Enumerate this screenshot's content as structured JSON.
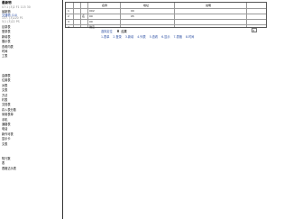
{
  "sidebar": {
    "title": "最新物",
    "lines": [
      {
        "text": "07:1 (3)2 F1 115 30",
        "tone": "grey"
      },
      {
        "text": "最新物",
        "tone": "normal"
      },
      {
        "text": "交通物 (14)",
        "tone": "blue"
      },
      {
        "text": "137. (3)220 P1",
        "tone": "grey"
      },
      {
        "text": "5/1 (3)22 PS",
        "tone": "grey"
      }
    ],
    "items": [
      "目录表",
      "登录表",
      "新增表",
      "展示表",
      "查看内表",
      "时间",
      "工表",
      "",
      "",
      "",
      "会期表",
      "位置表",
      "对表",
      "文表",
      "方法",
      "村表",
      "文档表",
      "存入表分数",
      "采用表单",
      "手机",
      "通路表",
      "电话",
      "新作可表",
      "显示卡",
      "文表",
      "",
      "",
      "知行数",
      "表",
      "表格达示表"
    ]
  },
  "grid": {
    "headers": [
      "名称",
      "地址",
      "说明"
    ],
    "rows": [
      {
        "num": "1",
        "a": "",
        "b": "",
        "c": "002",
        "d": "00"
      },
      {
        "num": "2",
        "a": "",
        "b": "名",
        "c": "00",
        "d": "05"
      },
      {
        "num": "3",
        "a": "",
        "b": "",
        "c": "00",
        "d": ""
      },
      {
        "num": "4",
        "a": "",
        "b": "",
        "c": "确定",
        "d": ""
      }
    ]
  },
  "prompt": {
    "label": "选择定位",
    "option": "结果"
  },
  "tabs": [
    "1.表单",
    "2.登录",
    "3.新增",
    "4.列表",
    "5.查看",
    "6.显示",
    "7.表格",
    "8.时间"
  ]
}
